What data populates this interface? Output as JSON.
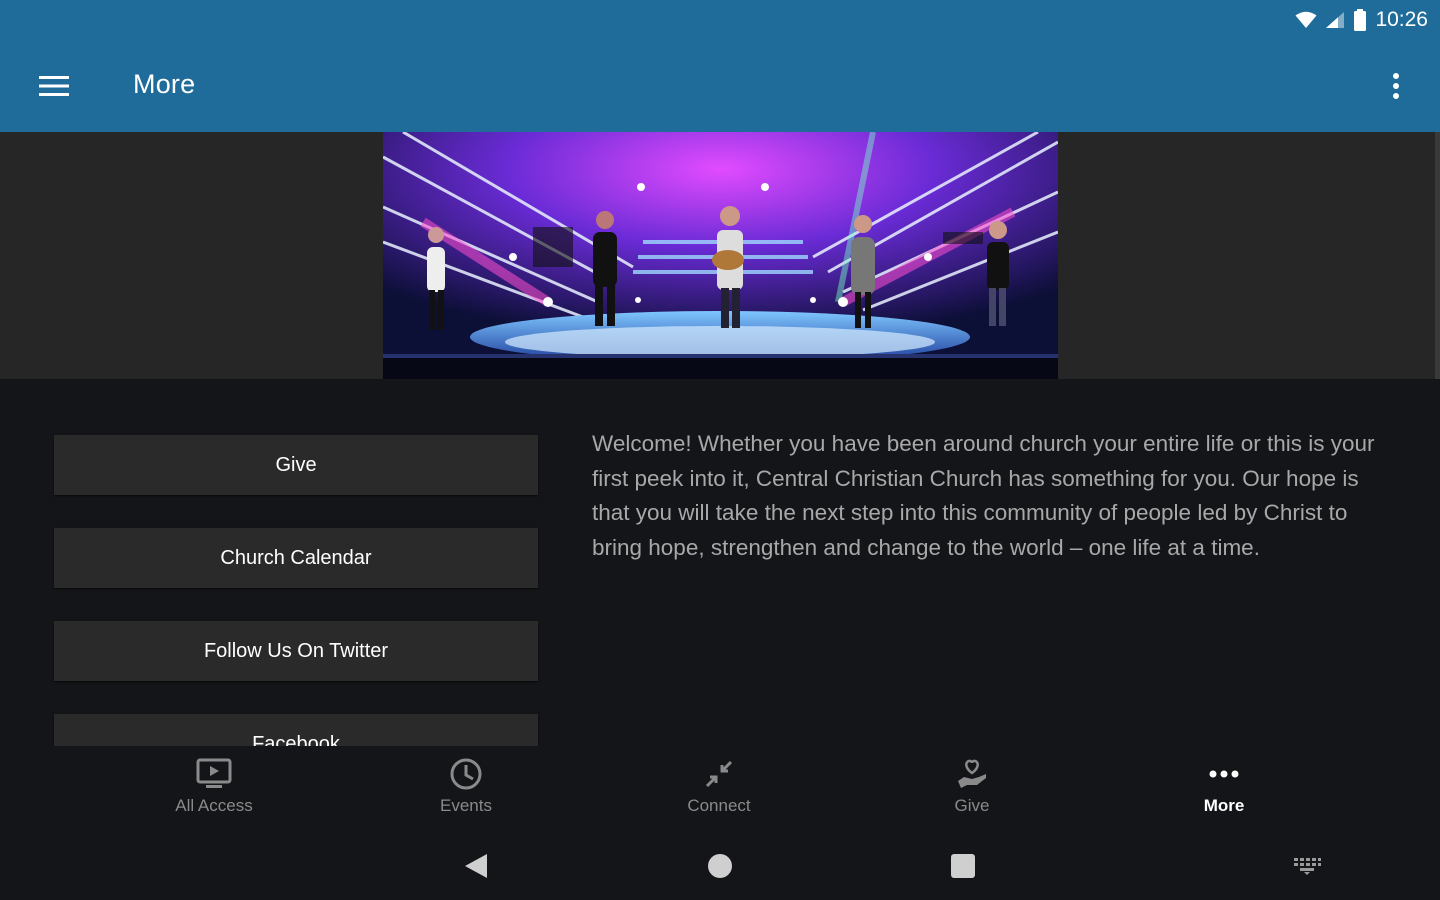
{
  "status_bar": {
    "time": "10:26"
  },
  "app_bar": {
    "title": "More"
  },
  "menu_buttons": [
    {
      "label": "Give"
    },
    {
      "label": "Church Calendar"
    },
    {
      "label": "Follow Us On Twitter"
    },
    {
      "label": "Facebook"
    }
  ],
  "welcome_text": "Welcome! Whether you have been around church your entire life or this is your first peek into it, Central Christian Church has something for you. Our hope is that you will take the next step into this community of people led by Christ to bring hope, strengthen and change to the world – one life at a time.",
  "bottom_nav": {
    "active": "More",
    "items": [
      {
        "label": "All Access",
        "icon": "tv-play-icon"
      },
      {
        "label": "Events",
        "icon": "clock-icon"
      },
      {
        "label": "Connect",
        "icon": "collapse-arrows-icon"
      },
      {
        "label": "Give",
        "icon": "heart-hand-icon"
      },
      {
        "label": "More",
        "icon": "more-dots-icon"
      }
    ]
  },
  "colors": {
    "app_bar": "#1f6c9b",
    "background": "#141518",
    "button": "#2a2a2a",
    "text_muted": "#a8a8a8"
  }
}
